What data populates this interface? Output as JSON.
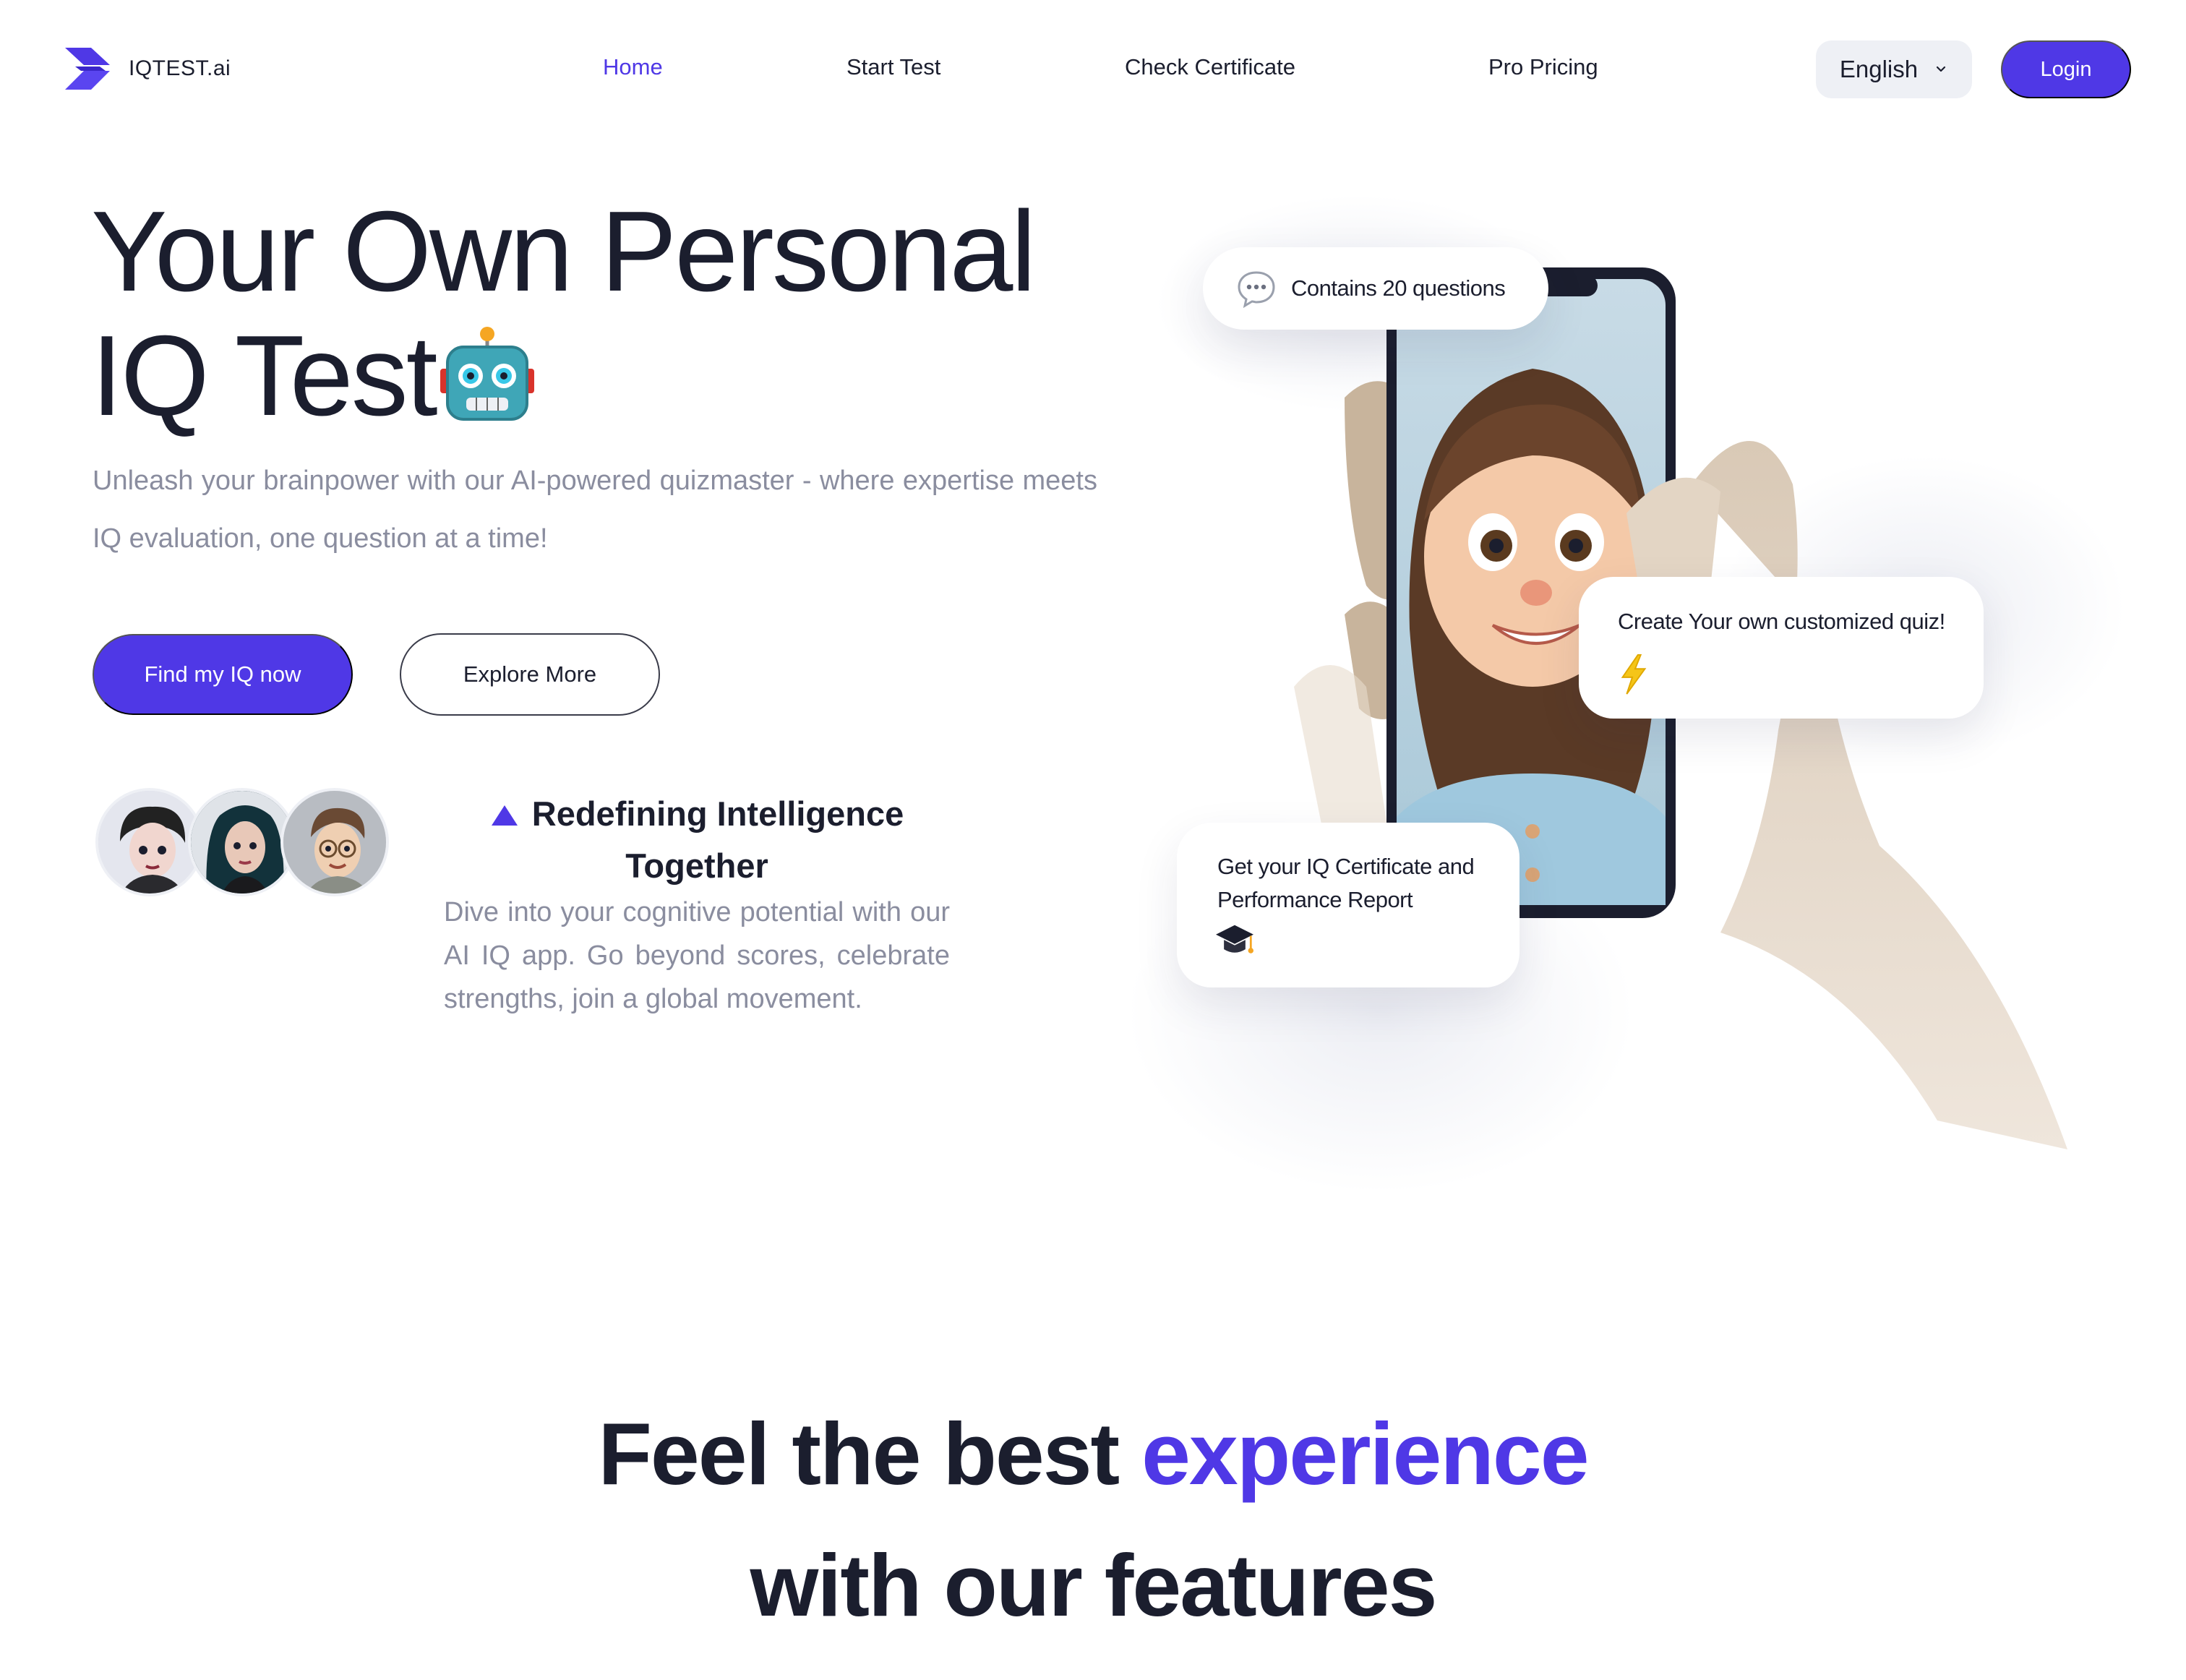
{
  "nav": {
    "brand": "IQTEST.ai",
    "links": [
      "Home",
      "Start Test",
      "Check Certificate",
      "Pro Pricing"
    ],
    "active": "Home",
    "language": "English",
    "login": "Login"
  },
  "hero": {
    "title_line1": "Your Own Personal",
    "title_line2": "IQ Test",
    "subtitle": "Unleash your brainpower with our AI-powered quizmaster - where expertise meets IQ evaluation, one question at a time!",
    "primary_cta": "Find my IQ now",
    "secondary_cta": "Explore More"
  },
  "redefining": {
    "title": "Redefining Intelligence Together",
    "text": "Dive into your cognitive potential with our AI IQ app. Go beyond scores, celebrate strengths, join a global movement."
  },
  "bubbles": {
    "questions": "Contains 20 questions",
    "custom_quiz": "Create Your own customized quiz!",
    "certificate": "Get your IQ Certificate and Performance Report"
  },
  "features": {
    "heading_part1": "Feel the best ",
    "heading_accent": "experience",
    "heading_part2": "with our features"
  },
  "colors": {
    "accent": "#4f38e6",
    "text": "#1b1e2e",
    "muted": "#8a8d9f"
  },
  "icons": [
    "logo-icon",
    "chevron-down-icon",
    "robot-icon",
    "triangle-icon",
    "chat-bubble-icon",
    "lightning-icon",
    "graduation-cap-icon"
  ]
}
